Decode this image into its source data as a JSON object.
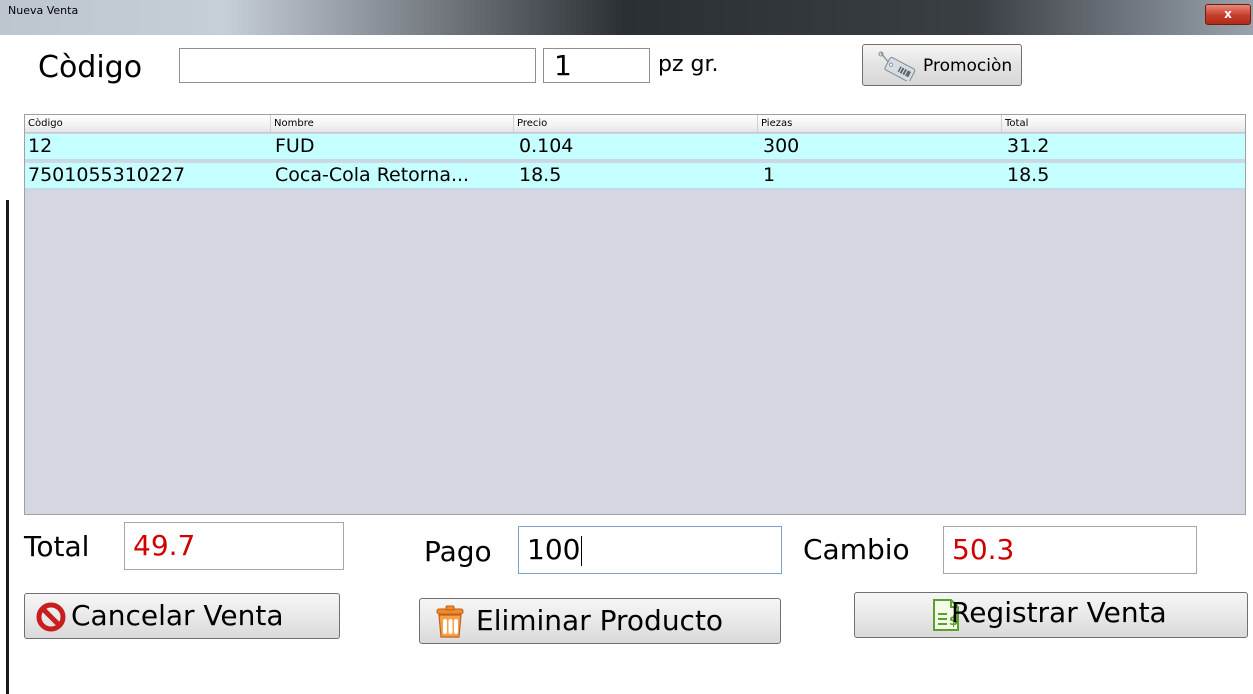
{
  "window": {
    "title": "Nueva Venta",
    "close_label": "x"
  },
  "header": {
    "codigo_label": "Còdigo",
    "codigo_value": "",
    "qty_value": "1",
    "unit_label": "pz gr.",
    "promo_button": "Promociòn"
  },
  "table": {
    "columns": [
      "Còdigo",
      "Nombre",
      "Precio",
      "Piezas",
      "Total"
    ],
    "rows": [
      [
        "12",
        "FUD",
        "0.104",
        "300",
        "31.2"
      ],
      [
        "7501055310227",
        "Coca-Cola Retorna...",
        "18.5",
        "1",
        "18.5"
      ]
    ]
  },
  "totals": {
    "total_label": "Total",
    "total_value": "49.7",
    "pago_label": "Pago",
    "pago_value": "100",
    "cambio_label": "Cambio",
    "cambio_value": "50.3"
  },
  "actions": {
    "cancel": "Cancelar Venta",
    "delete": "Eliminar Producto",
    "register": "Registrar Venta"
  },
  "colors": {
    "row_bg": "#c6ffff",
    "table_bg": "#d4d7df",
    "value_red": "#d00000"
  },
  "icons": {
    "promo": "price-tag-icon",
    "cancel": "prohibited-icon",
    "delete": "trash-icon",
    "register": "invoice-dollar-icon"
  }
}
